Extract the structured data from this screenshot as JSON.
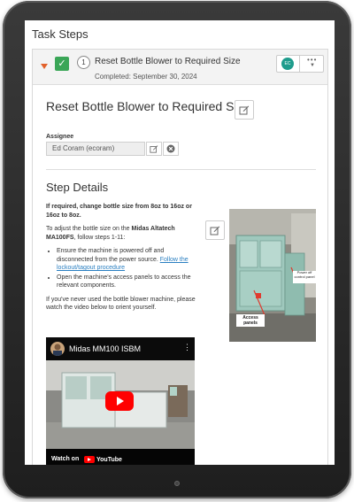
{
  "page": {
    "title": "Task Steps"
  },
  "step": {
    "number": "1",
    "title": "Reset Bottle Blower to Required Size",
    "completed": "Completed: September 30, 2024",
    "assignee_avatar": "EC",
    "more_label": "•••"
  },
  "detail": {
    "title": "Reset Bottle Blower to Required Size",
    "assignee_label": "Assignee",
    "assignee_value": "Ed Coram (ecoram)",
    "section_title": "Step Details",
    "instructions": {
      "lead_bold": "If required, change bottle size from 8oz to 16oz or 16oz to 8oz.",
      "para2_pre": "To adjust the bottle size on the ",
      "para2_bold": "Midas Altatech MA100FS",
      "para2_post": ", follow steps 1-11:",
      "bullet1_pre": "Ensure the machine is powered off and disconnected from the power source. ",
      "bullet1_link": "Follow the lockout/tagout procedure",
      "bullet2": "Open the machine's access panels to access the relevant components.",
      "para3": "If you've never used the bottle blower machine, please watch the video below to orient yourself."
    },
    "photo": {
      "label_power": "Power off control panel",
      "label_access": "Access panels"
    },
    "video": {
      "title": "Midas MM100 ISBM",
      "watch_on": "Watch on",
      "youtube": "YouTube"
    }
  },
  "colors": {
    "complete_green": "#3aa657",
    "caret_orange": "#e2612b",
    "avatar_teal": "#1e9c8c",
    "link_blue": "#2a7fc1"
  },
  "icons": [
    "caret-down-icon",
    "check-icon",
    "edit-icon",
    "close-circle-icon",
    "more-icon",
    "play-icon",
    "youtube-icon"
  ]
}
